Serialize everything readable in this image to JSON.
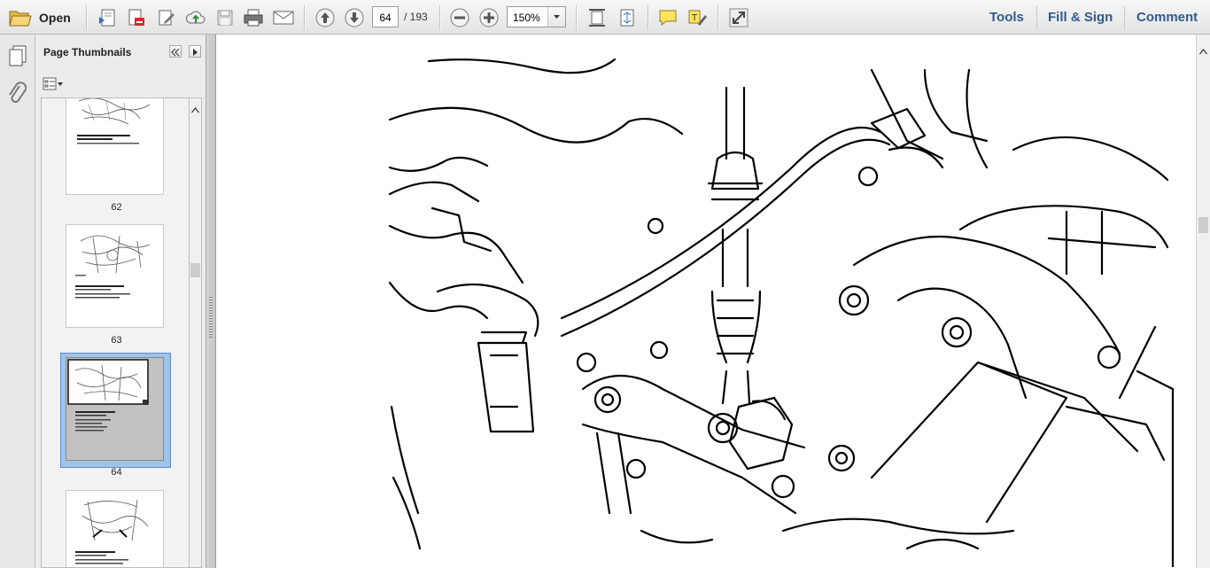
{
  "toolbar": {
    "open_label": "Open",
    "current_page": "64",
    "page_total": "/ 193",
    "zoom": "150%",
    "tools": "Tools",
    "fill_sign": "Fill & Sign",
    "comment": "Comment"
  },
  "panel": {
    "title": "Page Thumbnails"
  },
  "thumbnails": [
    {
      "label": "62"
    },
    {
      "label": "63"
    },
    {
      "label": "64"
    },
    {
      "label": ""
    }
  ],
  "colors": {
    "accent_link": "#2f5b8f",
    "selection": "#9fc4e8"
  }
}
